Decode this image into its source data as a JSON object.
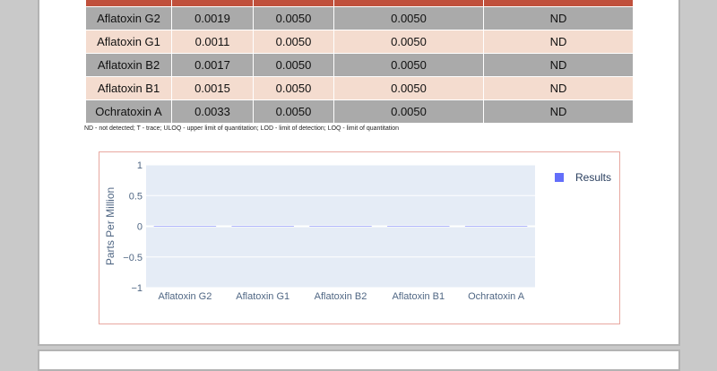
{
  "results_table": {
    "header": [
      "",
      "",
      "",
      "",
      ""
    ],
    "rows": [
      {
        "analyte": "Aflatoxin G2",
        "col2": "0.0019",
        "col3": "0.0050",
        "col4": "0.0050",
        "col5": "ND"
      },
      {
        "analyte": "Aflatoxin G1",
        "col2": "0.0011",
        "col3": "0.0050",
        "col4": "0.0050",
        "col5": "ND"
      },
      {
        "analyte": "Aflatoxin B2",
        "col2": "0.0017",
        "col3": "0.0050",
        "col4": "0.0050",
        "col5": "ND"
      },
      {
        "analyte": "Aflatoxin B1",
        "col2": "0.0015",
        "col3": "0.0050",
        "col4": "0.0050",
        "col5": "ND"
      },
      {
        "analyte": "Ochratoxin A",
        "col2": "0.0033",
        "col3": "0.0050",
        "col4": "0.0050",
        "col5": "ND"
      }
    ],
    "footnote": "ND - not detected; T - trace; ULOQ - upper limit of quantitation; LOD - limit of detection; LOQ - limit of quantitation"
  },
  "colors": {
    "header_bg": "#c0503c",
    "row_dark": "#aaaaaa",
    "row_light": "#f4dccf",
    "plot_bg": "#e5ecf6",
    "series": "#636efa"
  },
  "chart_data": {
    "type": "bar",
    "categories": [
      "Aflatoxin G2",
      "Aflatoxin G1",
      "Aflatoxin B2",
      "Aflatoxin B1",
      "Ochratoxin A"
    ],
    "series": [
      {
        "name": "Results",
        "values": [
          0,
          0,
          0,
          0,
          0
        ]
      }
    ],
    "ylabel": "Parts Per Million",
    "ylim": [
      -1,
      1
    ],
    "yticks": [
      1,
      0.5,
      0,
      -0.5,
      -1
    ],
    "ytick_labels": [
      "1",
      "0.5",
      "0",
      "−0.5",
      "−1"
    ],
    "grid": true,
    "legend_position": "top-right"
  }
}
